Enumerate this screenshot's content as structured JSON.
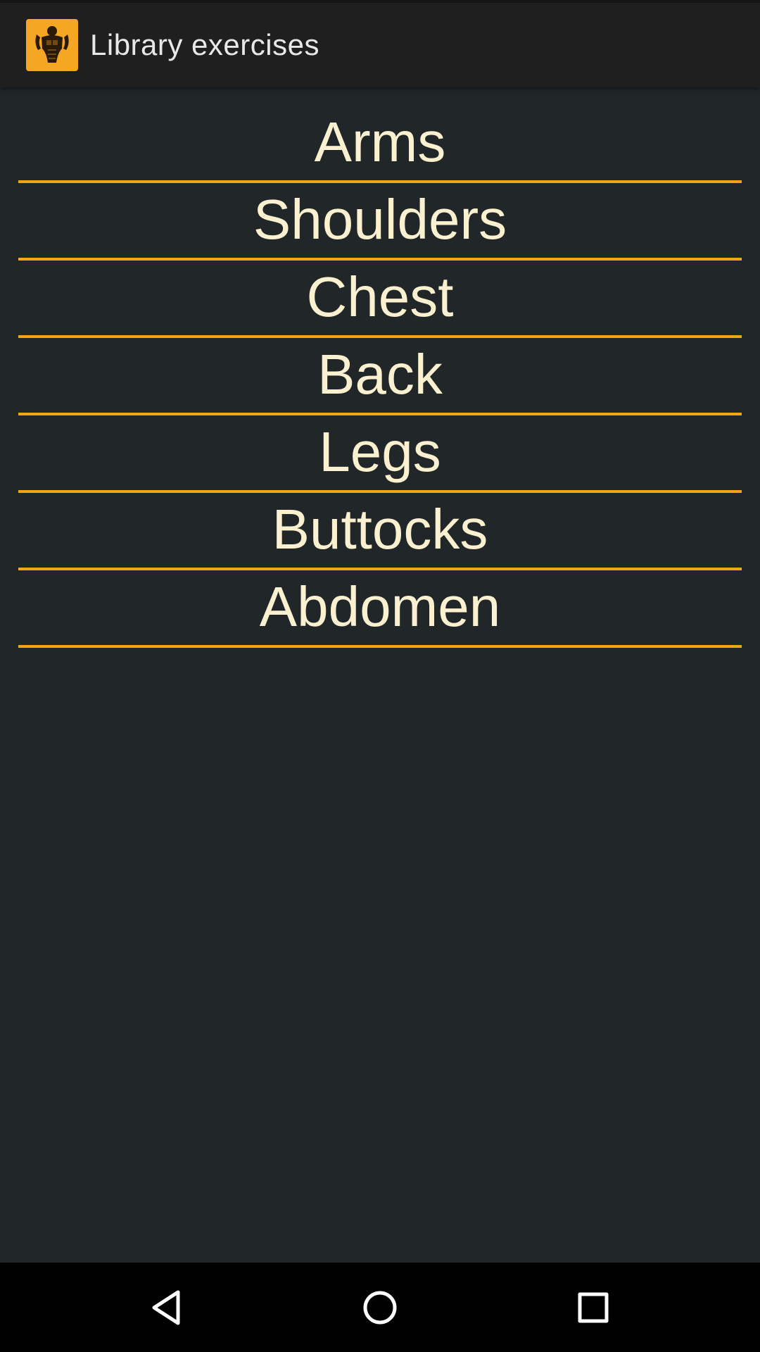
{
  "app_bar": {
    "icon": "muscle-man-icon",
    "title": "Library exercises"
  },
  "categories": [
    {
      "label": "Arms"
    },
    {
      "label": "Shoulders"
    },
    {
      "label": "Chest"
    },
    {
      "label": "Back"
    },
    {
      "label": "Legs"
    },
    {
      "label": "Buttocks"
    },
    {
      "label": "Abdomen"
    }
  ],
  "nav": {
    "back_icon": "back-triangle-icon",
    "home_icon": "home-circle-icon",
    "recents_icon": "recents-square-icon"
  },
  "colors": {
    "background": "#212628",
    "accent": "#f2a515",
    "text": "#fbf0cf",
    "toolbar": "#1f1f1f"
  }
}
